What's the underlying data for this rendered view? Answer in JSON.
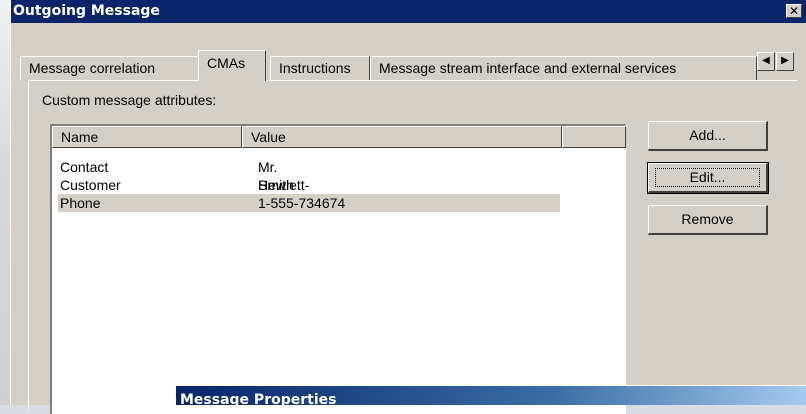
{
  "window": {
    "title": "Outgoing Message",
    "close_glyph": "✕"
  },
  "tabs": [
    {
      "label": "Message correlation"
    },
    {
      "label": "CMAs"
    },
    {
      "label": "Instructions"
    },
    {
      "label": "Message stream interface and external services"
    }
  ],
  "tab_scroll": {
    "left": "◀",
    "right": "▶"
  },
  "cma": {
    "section_label": "Custom message attributes:",
    "columns": [
      "Name",
      "Value",
      ""
    ],
    "rows": [
      {
        "name": "Contact",
        "value": "Mr. Smith"
      },
      {
        "name": "Customer",
        "value": "Hewlett-Packard"
      },
      {
        "name": "Phone",
        "value": "1-555-734674"
      }
    ]
  },
  "buttons": {
    "add": "Add...",
    "edit": "Edit...",
    "remove": "Remove"
  },
  "child_window": {
    "title": "Message Properties"
  }
}
